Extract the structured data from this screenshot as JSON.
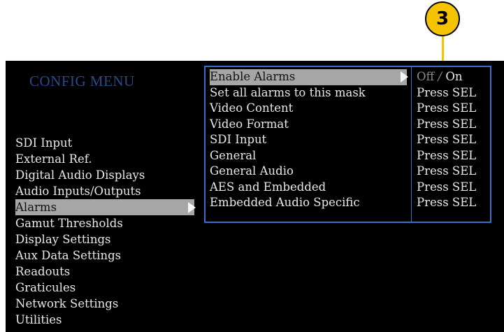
{
  "callout": {
    "number": "3"
  },
  "colors": {
    "accent_border": "#3a6fd0",
    "title": "#2b4a8c",
    "highlight": "#a6a6a6",
    "callout": "#f5c400"
  },
  "config_menu": {
    "title": "CONFIG MENU",
    "items": [
      {
        "label": "SDI Input"
      },
      {
        "label": "External Ref."
      },
      {
        "label": "Digital Audio Displays"
      },
      {
        "label": "Audio Inputs/Outputs"
      },
      {
        "label": "Alarms",
        "selected": true
      },
      {
        "label": "Gamut Thresholds"
      },
      {
        "label": "Display Settings"
      },
      {
        "label": "Aux Data Settings"
      },
      {
        "label": "Readouts"
      },
      {
        "label": "Graticules"
      },
      {
        "label": "Network Settings"
      },
      {
        "label": "Utilities"
      }
    ]
  },
  "alarms_submenu": {
    "rows": [
      {
        "label": "Enable Alarms",
        "value_off": "Off",
        "value_sep": "/",
        "value_on": "On"
      },
      {
        "label": "Set all alarms to this mask",
        "value": "Press SEL"
      },
      {
        "label": "Video Content",
        "value": "Press SEL"
      },
      {
        "label": "Video Format",
        "value": "Press SEL"
      },
      {
        "label": "SDI Input",
        "value": "Press SEL"
      },
      {
        "label": "General",
        "value": "Press SEL"
      },
      {
        "label": "General Audio",
        "value": "Press SEL"
      },
      {
        "label": "AES and Embedded",
        "value": "Press SEL"
      },
      {
        "label": "Embedded Audio Specific",
        "value": "Press SEL"
      }
    ]
  }
}
